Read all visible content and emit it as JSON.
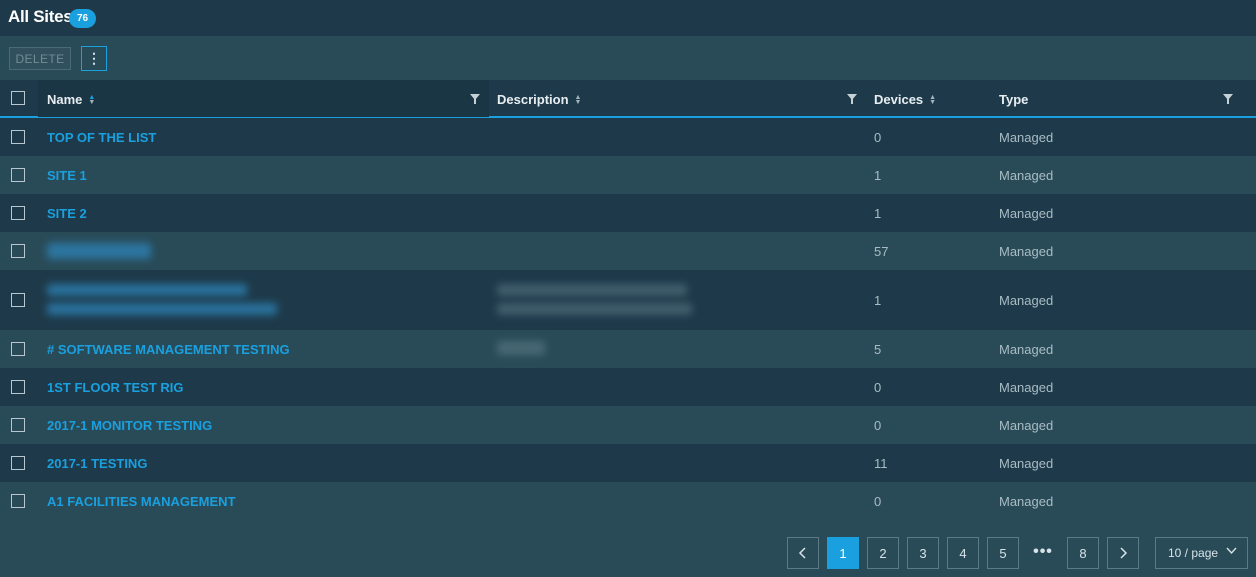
{
  "header": {
    "title": "All Sites",
    "count": "76"
  },
  "toolbar": {
    "delete_label": "DELETE",
    "more_label": "⋮"
  },
  "table": {
    "columns": {
      "name": "Name",
      "description": "Description",
      "devices": "Devices",
      "type": "Type"
    },
    "rows": [
      {
        "name": "TOP OF THE LIST",
        "devices": "0",
        "type": "Managed"
      },
      {
        "name": "SITE 1",
        "devices": "1",
        "type": "Managed"
      },
      {
        "name": "SITE 2",
        "devices": "1",
        "type": "Managed"
      },
      {
        "name": "",
        "devices": "57",
        "type": "Managed"
      },
      {
        "name": "",
        "devices": "1",
        "type": "Managed"
      },
      {
        "name": "# SOFTWARE MANAGEMENT TESTING",
        "devices": "5",
        "type": "Managed"
      },
      {
        "name": "1ST FLOOR TEST RIG",
        "devices": "0",
        "type": "Managed"
      },
      {
        "name": "2017-1 MONITOR TESTING",
        "devices": "0",
        "type": "Managed"
      },
      {
        "name": "2017-1 TESTING",
        "devices": "11",
        "type": "Managed"
      },
      {
        "name": "A1 FACILITIES MANAGEMENT",
        "devices": "0",
        "type": "Managed"
      }
    ]
  },
  "pagination": {
    "prev_icon": "chevron-left-icon",
    "next_icon": "chevron-right-icon",
    "pages": [
      "1",
      "2",
      "3",
      "4",
      "5",
      "8"
    ],
    "current": "1",
    "ellipsis": "•••",
    "page_size": "10 / page"
  },
  "colors": {
    "accent": "#1aa0df",
    "header_bg": "#1e3a4a",
    "row_bg": "#294b58"
  }
}
